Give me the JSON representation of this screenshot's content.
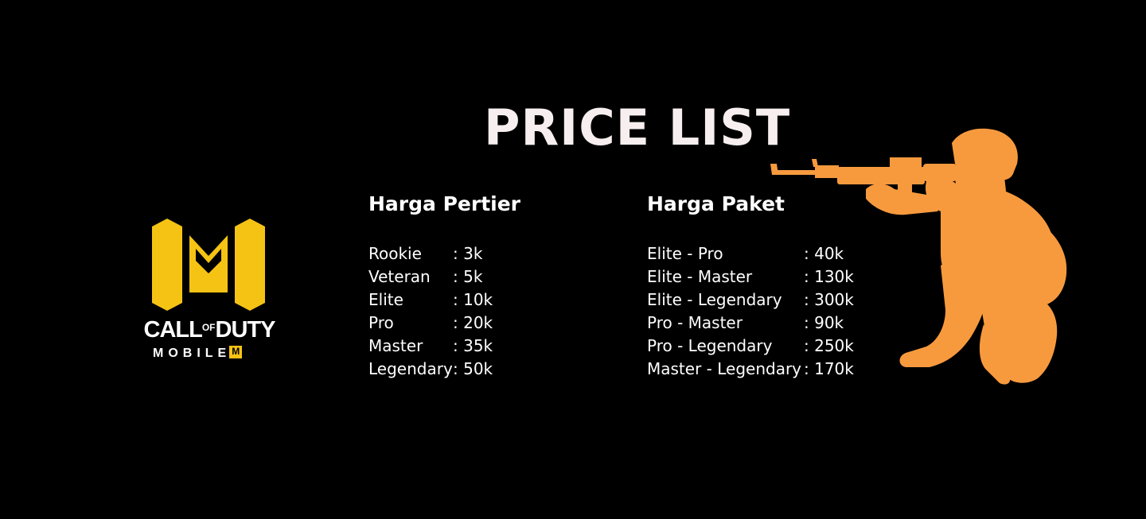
{
  "title": "PRICE LIST",
  "logo": {
    "word1_a": "CALL",
    "word1_of": "OF",
    "word1_b": "DUTY",
    "word2": "MOBILE",
    "brand_color": "#f5c313"
  },
  "tier_prices": {
    "heading": "Harga Pertier",
    "items": [
      {
        "name": "Rookie",
        "price": ": 3k"
      },
      {
        "name": "Veteran",
        "price": ": 5k"
      },
      {
        "name": "Elite",
        "price": ": 10k"
      },
      {
        "name": "Pro",
        "price": ": 20k"
      },
      {
        "name": "Master",
        "price": ": 35k"
      },
      {
        "name": "Legendary",
        "price": ": 50k"
      }
    ]
  },
  "package_prices": {
    "heading": "Harga Paket",
    "items": [
      {
        "name": "Elite - Pro",
        "price": ": 40k"
      },
      {
        "name": "Elite - Master",
        "price": ": 130k"
      },
      {
        "name": "Elite - Legendary",
        "price": ": 300k"
      },
      {
        "name": "Pro - Master",
        "price": ": 90k"
      },
      {
        "name": "Pro - Legendary",
        "price": ": 250k"
      },
      {
        "name": "Master - Legendary",
        "price": ": 170k"
      }
    ]
  },
  "colors": {
    "background": "#000000",
    "soldier": "#f79a3e",
    "title": "#f7efef"
  }
}
